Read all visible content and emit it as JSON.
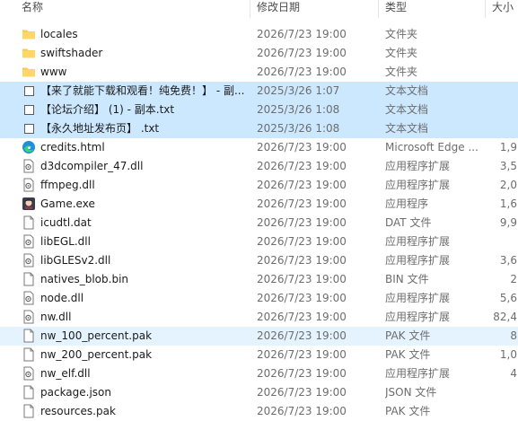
{
  "header": {
    "name": "名称",
    "date": "修改日期",
    "type": "类型",
    "size": "大小"
  },
  "files": [
    {
      "name": "locales",
      "date": "2026/7/23 19:00",
      "type": "文件夹",
      "size": "",
      "icon": "folder-icon",
      "selected": false
    },
    {
      "name": "swiftshader",
      "date": "2026/7/23 19:00",
      "type": "文件夹",
      "size": "",
      "icon": "folder-icon",
      "selected": false
    },
    {
      "name": "www",
      "date": "2026/7/23 19:00",
      "type": "文件夹",
      "size": "",
      "icon": "folder-icon",
      "selected": false
    },
    {
      "name": "【来了就能下载和观看！纯免费！】 - 副...",
      "date": "2025/3/26 1:07",
      "type": "文本文档",
      "size": "",
      "icon": "text-file-icon",
      "selected": true,
      "checkbox": true
    },
    {
      "name": "【论坛介绍】 (1) - 副本.txt",
      "date": "2025/3/26 1:08",
      "type": "文本文档",
      "size": "",
      "icon": "text-file-icon",
      "selected": true,
      "checkbox": true
    },
    {
      "name": "【永久地址发布页】 .txt",
      "date": "2025/3/26 1:08",
      "type": "文本文档",
      "size": "",
      "icon": "text-file-icon",
      "selected": true,
      "checkbox": true
    },
    {
      "name": "credits.html",
      "date": "2026/7/23 19:00",
      "type": "Microsoft Edge ...",
      "size": "1,9",
      "icon": "edge-icon",
      "selected": false
    },
    {
      "name": "d3dcompiler_47.dll",
      "date": "2026/7/23 19:00",
      "type": "应用程序扩展",
      "size": "3,5",
      "icon": "dll-file-icon",
      "selected": false
    },
    {
      "name": "ffmpeg.dll",
      "date": "2026/7/23 19:00",
      "type": "应用程序扩展",
      "size": "2,0",
      "icon": "dll-file-icon",
      "selected": false
    },
    {
      "name": "Game.exe",
      "date": "2026/7/23 19:00",
      "type": "应用程序",
      "size": "1,6",
      "icon": "game-exe-icon",
      "selected": false
    },
    {
      "name": "icudtl.dat",
      "date": "2026/7/23 19:00",
      "type": "DAT 文件",
      "size": "9,9",
      "icon": "file-icon",
      "selected": false
    },
    {
      "name": "libEGL.dll",
      "date": "2026/7/23 19:00",
      "type": "应用程序扩展",
      "size": "",
      "icon": "dll-file-icon",
      "selected": false
    },
    {
      "name": "libGLESv2.dll",
      "date": "2026/7/23 19:00",
      "type": "应用程序扩展",
      "size": "3,6",
      "icon": "dll-file-icon",
      "selected": false
    },
    {
      "name": "natives_blob.bin",
      "date": "2026/7/23 19:00",
      "type": "BIN 文件",
      "size": "2",
      "icon": "file-icon",
      "selected": false
    },
    {
      "name": "node.dll",
      "date": "2026/7/23 19:00",
      "type": "应用程序扩展",
      "size": "5,6",
      "icon": "dll-file-icon",
      "selected": false
    },
    {
      "name": "nw.dll",
      "date": "2026/7/23 19:00",
      "type": "应用程序扩展",
      "size": "82,4",
      "icon": "dll-file-icon",
      "selected": false
    },
    {
      "name": "nw_100_percent.pak",
      "date": "2026/7/23 19:00",
      "type": "PAK 文件",
      "size": "8",
      "icon": "file-icon",
      "selected": false,
      "hover": true
    },
    {
      "name": "nw_200_percent.pak",
      "date": "2026/7/23 19:00",
      "type": "PAK 文件",
      "size": "1,0",
      "icon": "file-icon",
      "selected": false
    },
    {
      "name": "nw_elf.dll",
      "date": "2026/7/23 19:00",
      "type": "应用程序扩展",
      "size": "4",
      "icon": "dll-file-icon",
      "selected": false
    },
    {
      "name": "package.json",
      "date": "2026/7/23 19:00",
      "type": "JSON 文件",
      "size": "",
      "icon": "file-icon",
      "selected": false
    },
    {
      "name": "resources.pak",
      "date": "2026/7/23 19:00",
      "type": "PAK 文件",
      "size": "",
      "icon": "file-icon",
      "selected": false
    }
  ],
  "colors": {
    "selection": "#cce8ff",
    "hover": "#e5f3ff",
    "folder": "#f8c94c",
    "secondary_text": "#6d6d6d"
  }
}
